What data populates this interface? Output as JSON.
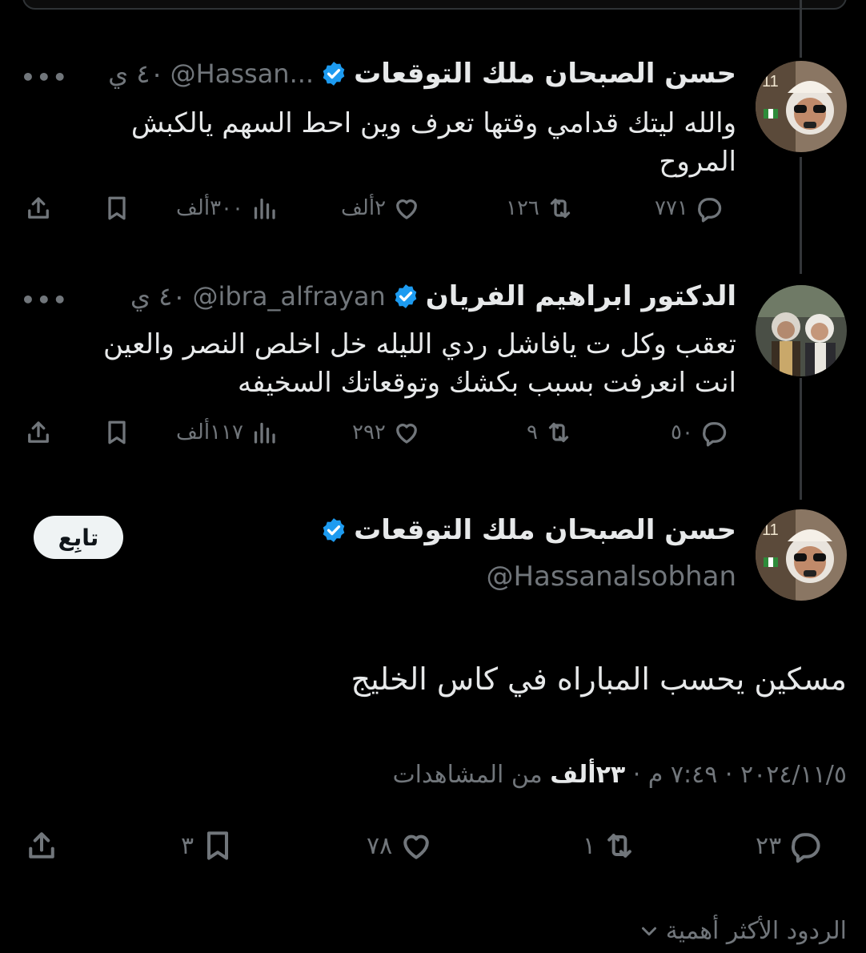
{
  "tweets": [
    {
      "name": "حسن الصبحان ملك التوقعات",
      "handle": "@Hassan...",
      "time": "٤٠ ي",
      "text_line1": "والله ليتك قدامي وقتها تعرف وين احط السهم يالكبش",
      "text_line2": "المروح",
      "replies": "٧٧١",
      "reposts": "١٢٦",
      "likes": "٢ألف",
      "views": "٣٠٠ألف"
    },
    {
      "name": "الدكتور ابراهيم الفريان",
      "handle": "@ibra_alfrayan",
      "time": "٤٠ ي",
      "text_line1": "تعقب وكل ت يافاشل ردي الليله خل اخلص النصر والعين",
      "text_line2": "انت انعرفت بسبب بكشك وتوقعاتك السخيفه",
      "replies": "٥٠",
      "reposts": "٩",
      "likes": "٢٩٢",
      "views": "١١٧ألف"
    }
  ],
  "main_tweet": {
    "name": "حسن الصبحان ملك التوقعات",
    "handle": "@Hassanalsobhan",
    "follow_label": "تابِع",
    "text": "مسكين يحسب المباراه في كاس الخليج",
    "meta_prefix": "٢٠٢٤/١١/٥ · ٧:٤٩ م · ",
    "views_count": "٢٣ألف",
    "views_label": " من المشاهدات",
    "replies": "٢٣",
    "reposts": "١",
    "likes": "٧٨",
    "bookmarks": "٣"
  },
  "replies_sort_label": "الردود الأكثر أهمية",
  "icons": {
    "reply": "reply-icon",
    "repost": "repost-icon",
    "like": "heart-icon",
    "views": "views-icon",
    "bookmark": "bookmark-icon",
    "share": "share-icon",
    "verified": "verified-badge-icon",
    "more": "more-icon",
    "chevron": "chevron-down-icon"
  },
  "colors": {
    "background": "#000000",
    "text": "#e7e9ea",
    "secondary": "#71767b",
    "verified": "#1d9bf0",
    "follow_bg": "#eff3f4"
  }
}
